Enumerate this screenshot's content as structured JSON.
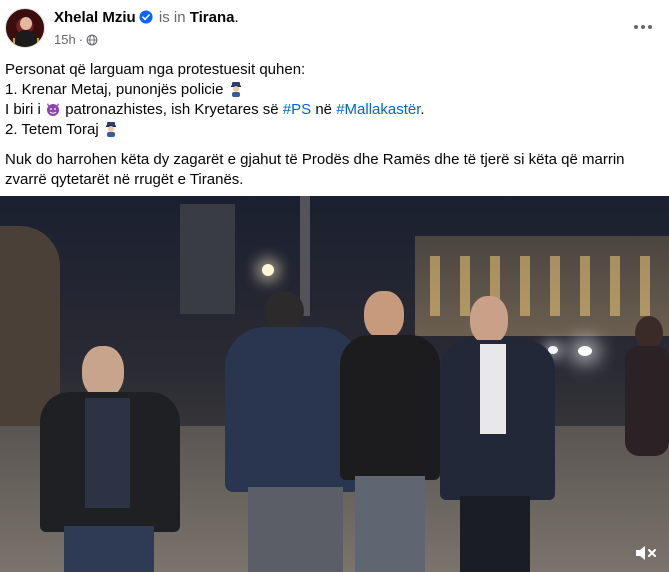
{
  "post": {
    "author": "Xhelal Mziu",
    "is_in_text": "is in",
    "place": "Tirana",
    "place_suffix": ".",
    "time": "15h",
    "privacy_icon": "globe-icon",
    "more_icon": "more-options-icon"
  },
  "text": {
    "line1": "Personat që larguam nga protestuesit quhen:",
    "line2_prefix": "1. Krenar Metaj, punonjës policie",
    "line3_prefix": "I biri i",
    "line3_mid": "patronazhistes, ish Kryetares së",
    "hashtag1": "#PS",
    "line3_ne": "në",
    "hashtag2": "#Mallakastër",
    "line3_end": ".",
    "line4_prefix": "2. Tetem Toraj",
    "paragraph2": "Nuk do harrohen këta dy zagarët e gjahut të Prodës dhe Ramës dhe të tjerë si këta që marrin zvarrë qytetarët në rrugët e Tiranës."
  },
  "icons": {
    "verified": "verified-badge-icon",
    "police": "police-officer-emoji",
    "devil": "smiling-devil-emoji",
    "sound": "muted-speaker-icon"
  },
  "colors": {
    "text": "#050505",
    "secondary": "#65676b",
    "hashtag": "#0064d1",
    "verified": "#0866ff",
    "devil": "#8e44ad"
  }
}
